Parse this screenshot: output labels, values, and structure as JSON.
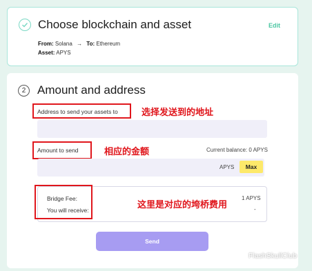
{
  "step1": {
    "title": "Choose blockchain and asset",
    "edit": "Edit",
    "from_label": "From:",
    "from_value": "Solana",
    "arrow": "→",
    "to_label": "To:",
    "to_value": "Ethereum",
    "asset_label": "Asset:",
    "asset_value": "APYS"
  },
  "step2": {
    "number": "2",
    "title": "Amount and address",
    "address_label": "Address to send your assets to",
    "address_annotation": "选择发送到的地址",
    "address_value": "",
    "amount_label": "Amount to send",
    "amount_annotation": "相应的金额",
    "current_balance": "Current balance: 0 APYS",
    "amount_unit": "APYS",
    "max_label": "Max",
    "bridge_fee_label": "Bridge Fee:",
    "bridge_fee_value": "1 APYS",
    "receive_label": "You will receive:",
    "receive_value": "-",
    "fee_annotation": "这里是对应的垮桥费用",
    "send_label": "Send"
  },
  "watermark": "FlashSkullClub",
  "colors": {
    "accent_teal": "#4dc7a3",
    "send_purple": "#a79cf2",
    "max_yellow": "#fde96a",
    "annotation_red": "#e0161c",
    "background": "#e6f4ef"
  }
}
